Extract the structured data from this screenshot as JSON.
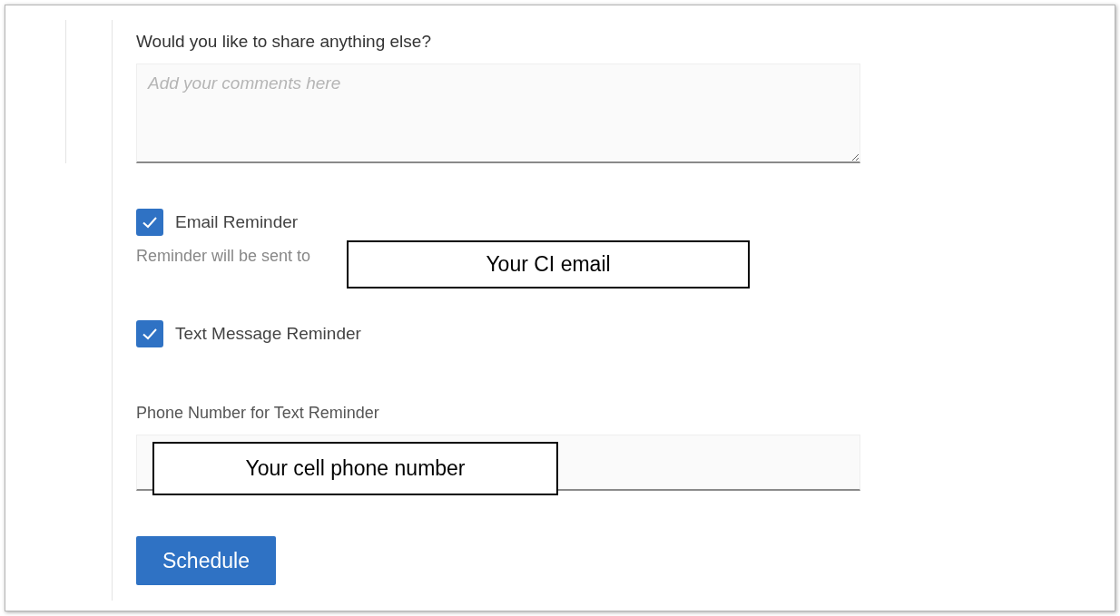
{
  "comments": {
    "label": "Would you like to share anything else?",
    "placeholder": "Add your comments here"
  },
  "reminders": [
    {
      "label": "Email Reminder",
      "checked": true,
      "note": "Reminder will be sent to",
      "callout": "Your CI email"
    },
    {
      "label": "Text Message Reminder",
      "checked": true
    }
  ],
  "phone": {
    "label": "Phone Number for Text Reminder",
    "callout": "Your cell phone number"
  },
  "button": "Schedule"
}
